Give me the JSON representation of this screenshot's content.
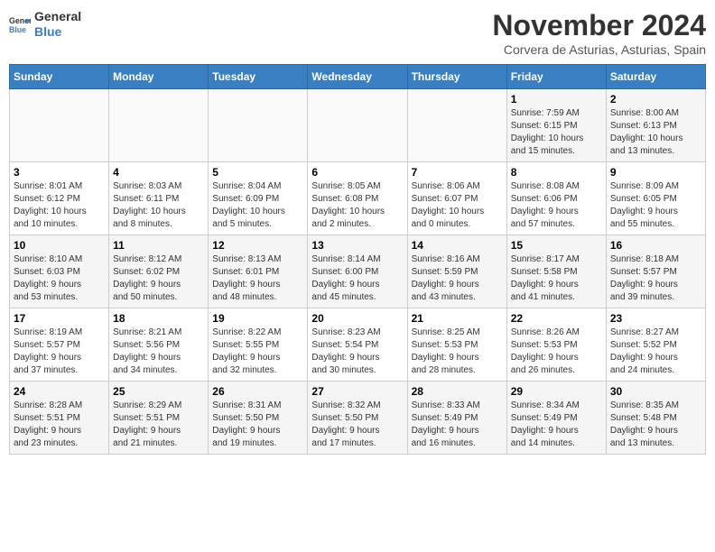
{
  "header": {
    "logo_general": "General",
    "logo_blue": "Blue",
    "month_title": "November 2024",
    "location": "Corvera de Asturias, Asturias, Spain"
  },
  "weekdays": [
    "Sunday",
    "Monday",
    "Tuesday",
    "Wednesday",
    "Thursday",
    "Friday",
    "Saturday"
  ],
  "weeks": [
    [
      {
        "day": "",
        "info": ""
      },
      {
        "day": "",
        "info": ""
      },
      {
        "day": "",
        "info": ""
      },
      {
        "day": "",
        "info": ""
      },
      {
        "day": "",
        "info": ""
      },
      {
        "day": "1",
        "info": "Sunrise: 7:59 AM\nSunset: 6:15 PM\nDaylight: 10 hours\nand 15 minutes."
      },
      {
        "day": "2",
        "info": "Sunrise: 8:00 AM\nSunset: 6:13 PM\nDaylight: 10 hours\nand 13 minutes."
      }
    ],
    [
      {
        "day": "3",
        "info": "Sunrise: 8:01 AM\nSunset: 6:12 PM\nDaylight: 10 hours\nand 10 minutes."
      },
      {
        "day": "4",
        "info": "Sunrise: 8:03 AM\nSunset: 6:11 PM\nDaylight: 10 hours\nand 8 minutes."
      },
      {
        "day": "5",
        "info": "Sunrise: 8:04 AM\nSunset: 6:09 PM\nDaylight: 10 hours\nand 5 minutes."
      },
      {
        "day": "6",
        "info": "Sunrise: 8:05 AM\nSunset: 6:08 PM\nDaylight: 10 hours\nand 2 minutes."
      },
      {
        "day": "7",
        "info": "Sunrise: 8:06 AM\nSunset: 6:07 PM\nDaylight: 10 hours\nand 0 minutes."
      },
      {
        "day": "8",
        "info": "Sunrise: 8:08 AM\nSunset: 6:06 PM\nDaylight: 9 hours\nand 57 minutes."
      },
      {
        "day": "9",
        "info": "Sunrise: 8:09 AM\nSunset: 6:05 PM\nDaylight: 9 hours\nand 55 minutes."
      }
    ],
    [
      {
        "day": "10",
        "info": "Sunrise: 8:10 AM\nSunset: 6:03 PM\nDaylight: 9 hours\nand 53 minutes."
      },
      {
        "day": "11",
        "info": "Sunrise: 8:12 AM\nSunset: 6:02 PM\nDaylight: 9 hours\nand 50 minutes."
      },
      {
        "day": "12",
        "info": "Sunrise: 8:13 AM\nSunset: 6:01 PM\nDaylight: 9 hours\nand 48 minutes."
      },
      {
        "day": "13",
        "info": "Sunrise: 8:14 AM\nSunset: 6:00 PM\nDaylight: 9 hours\nand 45 minutes."
      },
      {
        "day": "14",
        "info": "Sunrise: 8:16 AM\nSunset: 5:59 PM\nDaylight: 9 hours\nand 43 minutes."
      },
      {
        "day": "15",
        "info": "Sunrise: 8:17 AM\nSunset: 5:58 PM\nDaylight: 9 hours\nand 41 minutes."
      },
      {
        "day": "16",
        "info": "Sunrise: 8:18 AM\nSunset: 5:57 PM\nDaylight: 9 hours\nand 39 minutes."
      }
    ],
    [
      {
        "day": "17",
        "info": "Sunrise: 8:19 AM\nSunset: 5:57 PM\nDaylight: 9 hours\nand 37 minutes."
      },
      {
        "day": "18",
        "info": "Sunrise: 8:21 AM\nSunset: 5:56 PM\nDaylight: 9 hours\nand 34 minutes."
      },
      {
        "day": "19",
        "info": "Sunrise: 8:22 AM\nSunset: 5:55 PM\nDaylight: 9 hours\nand 32 minutes."
      },
      {
        "day": "20",
        "info": "Sunrise: 8:23 AM\nSunset: 5:54 PM\nDaylight: 9 hours\nand 30 minutes."
      },
      {
        "day": "21",
        "info": "Sunrise: 8:25 AM\nSunset: 5:53 PM\nDaylight: 9 hours\nand 28 minutes."
      },
      {
        "day": "22",
        "info": "Sunrise: 8:26 AM\nSunset: 5:53 PM\nDaylight: 9 hours\nand 26 minutes."
      },
      {
        "day": "23",
        "info": "Sunrise: 8:27 AM\nSunset: 5:52 PM\nDaylight: 9 hours\nand 24 minutes."
      }
    ],
    [
      {
        "day": "24",
        "info": "Sunrise: 8:28 AM\nSunset: 5:51 PM\nDaylight: 9 hours\nand 23 minutes."
      },
      {
        "day": "25",
        "info": "Sunrise: 8:29 AM\nSunset: 5:51 PM\nDaylight: 9 hours\nand 21 minutes."
      },
      {
        "day": "26",
        "info": "Sunrise: 8:31 AM\nSunset: 5:50 PM\nDaylight: 9 hours\nand 19 minutes."
      },
      {
        "day": "27",
        "info": "Sunrise: 8:32 AM\nSunset: 5:50 PM\nDaylight: 9 hours\nand 17 minutes."
      },
      {
        "day": "28",
        "info": "Sunrise: 8:33 AM\nSunset: 5:49 PM\nDaylight: 9 hours\nand 16 minutes."
      },
      {
        "day": "29",
        "info": "Sunrise: 8:34 AM\nSunset: 5:49 PM\nDaylight: 9 hours\nand 14 minutes."
      },
      {
        "day": "30",
        "info": "Sunrise: 8:35 AM\nSunset: 5:48 PM\nDaylight: 9 hours\nand 13 minutes."
      }
    ]
  ]
}
